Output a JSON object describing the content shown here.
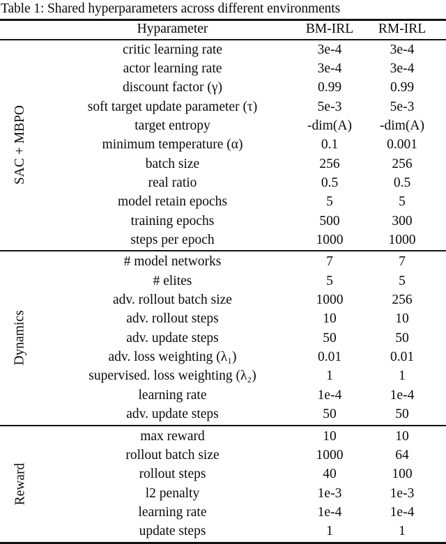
{
  "caption": "Table 1: Shared hyperparameters across different environments",
  "table": {
    "columns": {
      "param": "Hyparameter",
      "col1": "BM-IRL",
      "col2": "RM-IRL"
    },
    "sections": [
      {
        "label": "SAC + MBPO",
        "rows": [
          {
            "name": "critic learning rate",
            "bm": "3e-4",
            "rm": "3e-4"
          },
          {
            "name": "actor learning rate",
            "bm": "3e-4",
            "rm": "3e-4"
          },
          {
            "name": "discount factor (γ)",
            "bm": "0.99",
            "rm": "0.99"
          },
          {
            "name": "soft target update parameter (τ)",
            "bm": "5e-3",
            "rm": "5e-3"
          },
          {
            "name": "target entropy",
            "bm": "-dim(A)",
            "rm": "-dim(A)"
          },
          {
            "name": "minimum temperature (α)",
            "bm": "0.1",
            "rm": "0.001"
          },
          {
            "name": "batch size",
            "bm": "256",
            "rm": "256"
          },
          {
            "name": "real ratio",
            "bm": "0.5",
            "rm": "0.5"
          },
          {
            "name": "model retain epochs",
            "bm": "5",
            "rm": "5"
          },
          {
            "name": "training epochs",
            "bm": "500",
            "rm": "300"
          },
          {
            "name": "steps per epoch",
            "bm": "1000",
            "rm": "1000"
          }
        ]
      },
      {
        "label": "Dynamics",
        "rows": [
          {
            "name": "# model networks",
            "bm": "7",
            "rm": "7"
          },
          {
            "name": "# elites",
            "bm": "5",
            "rm": "5"
          },
          {
            "name": "adv. rollout batch size",
            "bm": "1000",
            "rm": "256"
          },
          {
            "name": "adv. rollout steps",
            "bm": "10",
            "rm": "10"
          },
          {
            "name": "adv. update steps",
            "bm": "50",
            "rm": "50"
          },
          {
            "name": "adv. loss weighting (λ₁)",
            "bm": "0.01",
            "rm": "0.01"
          },
          {
            "name": "supervised. loss weighting (λ₂)",
            "bm": "1",
            "rm": "1"
          },
          {
            "name": "learning rate",
            "bm": "1e-4",
            "rm": "1e-4"
          },
          {
            "name": "adv. update steps",
            "bm": "50",
            "rm": "50"
          }
        ]
      },
      {
        "label": "Reward",
        "rows": [
          {
            "name": "max reward",
            "bm": "10",
            "rm": "10"
          },
          {
            "name": "rollout batch size",
            "bm": "1000",
            "rm": "64"
          },
          {
            "name": "rollout steps",
            "bm": "40",
            "rm": "100"
          },
          {
            "name": "l2 penalty",
            "bm": "1e-3",
            "rm": "1e-3"
          },
          {
            "name": "learning rate",
            "bm": "1e-4",
            "rm": "1e-4"
          },
          {
            "name": "update steps",
            "bm": "1",
            "rm": "1"
          }
        ]
      }
    ]
  }
}
